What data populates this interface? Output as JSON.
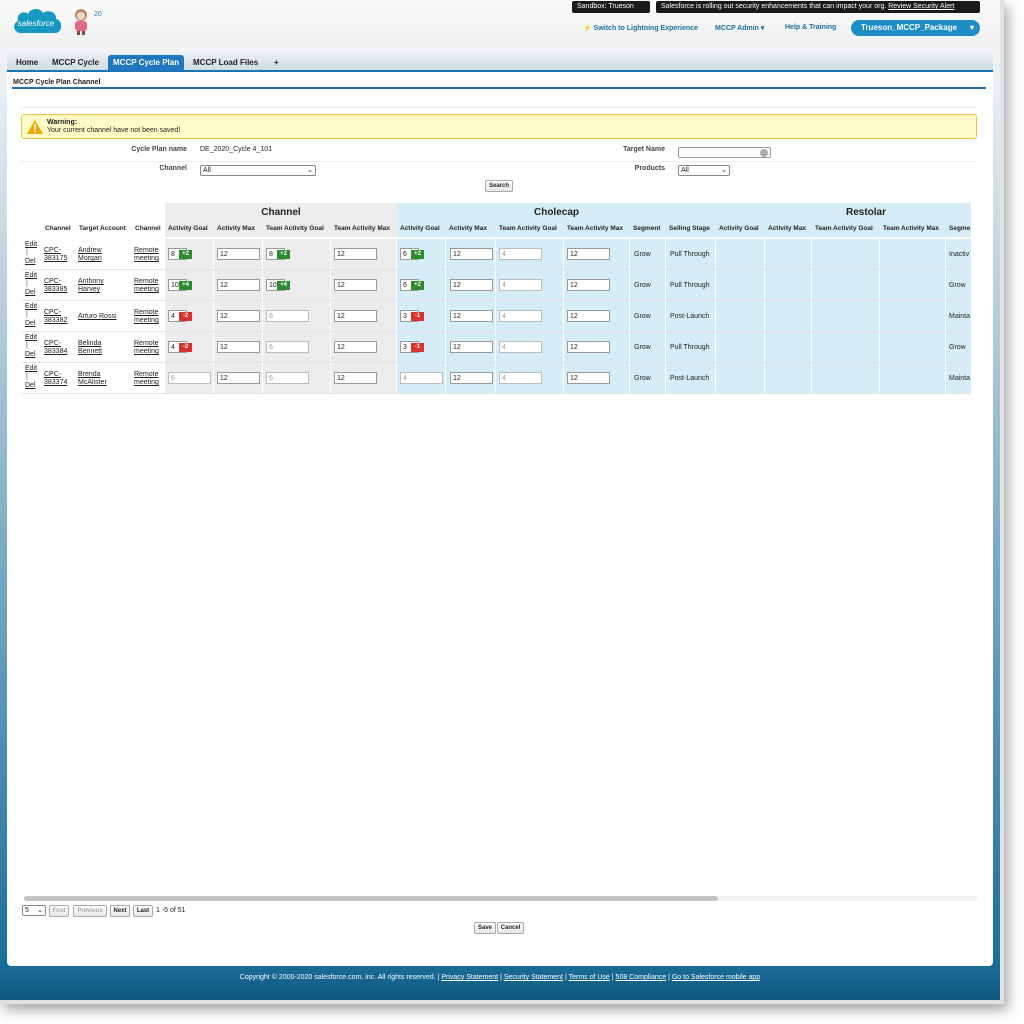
{
  "header": {
    "logo_text": "salesforce",
    "year_badge": "20",
    "sandbox": "Sandbox:   Trueson",
    "security_message": "Salesforce is rolling out security enhancements that can impact your org.",
    "security_link": "Review Security Alert",
    "switch_lightning": "Switch to Lightning Experience",
    "admin_menu": "MCCP Admin",
    "help": "Help & Training",
    "package_menu": "Trueson_MCCP_Package"
  },
  "tabs": [
    {
      "label": "Home"
    },
    {
      "label": "MCCP Cycle"
    },
    {
      "label": "MCCP Cycle Plan",
      "active": true
    },
    {
      "label": "MCCP Load Files"
    },
    {
      "label": "+"
    }
  ],
  "page_title": "MCCP Cycle Plan Channel",
  "warning": {
    "title": "Warning:",
    "message": "Your current channel have not been saved!"
  },
  "filters": {
    "cycle_plan_label": "Cycle Plan name",
    "cycle_plan_value": "DE_2020_Cycle 4_101",
    "target_name_label": "Target Name",
    "channel_label": "Channel",
    "channel_value": "All",
    "products_label": "Products",
    "products_value": "All",
    "search_label": "Search"
  },
  "grid": {
    "group_headers": [
      "Channel",
      "Cholecap",
      "Restolar"
    ],
    "columns": [
      "Channel",
      "Target Account",
      "Channel",
      "Activity Goal",
      "Activity Max",
      "Team Activity Goal",
      "Team Activity Max",
      "Activity Goal",
      "Activity Max",
      "Team Activity Goal",
      "Team Activity Max",
      "Segment",
      "Selling Stage",
      "Activity Goal",
      "Activity Max",
      "Team Activity Goal",
      "Team Activity Max",
      "Segme"
    ],
    "action_edit": "Edit",
    "action_sep": "|",
    "action_del": "Del",
    "rows": [
      {
        "id1": "CPC-",
        "id2": "383175",
        "acc1": "Andrew",
        "acc2": "Morgan",
        "ch1": "Remote",
        "ch2": "meeting",
        "ag": "8",
        "ag_badge": "+2",
        "am": "12",
        "tag": "8",
        "tag_badge": "+2",
        "tam": "12",
        "c_ag": "6",
        "c_ag_badge": "+2",
        "c_am": "12",
        "c_tag": "4",
        "c_tam": "12",
        "segment": "Grow",
        "stage": "Pull Through",
        "r_seg": "Inactiv"
      },
      {
        "id1": "CPC-",
        "id2": "383385",
        "acc1": "Anthony",
        "acc2": "Harvey",
        "ch1": "Remote",
        "ch2": "meeting",
        "ag": "10",
        "ag_badge": "+4",
        "am": "12",
        "tag": "10",
        "tag_badge": "+4",
        "tam": "12",
        "c_ag": "6",
        "c_ag_badge": "+2",
        "c_am": "12",
        "c_tag": "4",
        "c_tam": "12",
        "segment": "Grow",
        "stage": "Pull Through",
        "r_seg": "Grow"
      },
      {
        "id1": "CPC-",
        "id2": "383382",
        "acc1": "Arturo Rossi",
        "acc2": "",
        "ch1": "Remote",
        "ch2": "meeting",
        "ag": "4",
        "ag_badge": "-2",
        "am": "12",
        "tag": "6",
        "tag_badge": "",
        "tam": "12",
        "c_ag": "3",
        "c_ag_badge": "-1",
        "c_am": "12",
        "c_tag": "4",
        "c_tam": "12",
        "segment": "Grow",
        "stage": "Post-Launch",
        "r_seg": "Mainta"
      },
      {
        "id1": "CPC-",
        "id2": "383384",
        "acc1": "Belinda",
        "acc2": "Bennett",
        "ch1": "Remote",
        "ch2": "meeting",
        "ag": "4",
        "ag_badge": "-2",
        "am": "12",
        "tag": "6",
        "tag_badge": "",
        "tam": "12",
        "c_ag": "3",
        "c_ag_badge": "-1",
        "c_am": "12",
        "c_tag": "4",
        "c_tam": "12",
        "segment": "Grow",
        "stage": "Pull Through",
        "r_seg": "Grow"
      },
      {
        "id1": "CPC-",
        "id2": "383374",
        "acc1": "Brenda",
        "acc2": "McAlister",
        "ch1": "Remote",
        "ch2": "meeting",
        "ag": "6",
        "ag_badge": "",
        "am": "12",
        "tag": "6",
        "tag_badge": "",
        "tam": "12",
        "c_ag": "4",
        "c_ag_badge": "",
        "c_am": "12",
        "c_tag": "4",
        "c_tam": "12",
        "segment": "Grow",
        "stage": "Post-Launch",
        "r_seg": "Mainta"
      }
    ]
  },
  "pagination": {
    "page_size": "5",
    "first": "First",
    "previous": "Previous",
    "next": "Next",
    "last": "Last",
    "count": "1 -5 of 51"
  },
  "actions": {
    "save": "Save",
    "cancel": "Cancel"
  },
  "footer": {
    "copyright": "Copyright © 2000-2020 salesforce.com, inc. All rights reserved. |",
    "links": [
      "Privacy Statement",
      "Security Statement",
      "Terms of Use",
      "508 Compliance",
      "Go to Salesforce mobile app"
    ]
  },
  "colors": {
    "brand": "#1d8dc6",
    "tab_active": "#1f77c0",
    "positive": "#2e8b2e",
    "negative": "#d9332e",
    "group_blue": "#d6ecf6",
    "group_gray": "#ececec"
  }
}
